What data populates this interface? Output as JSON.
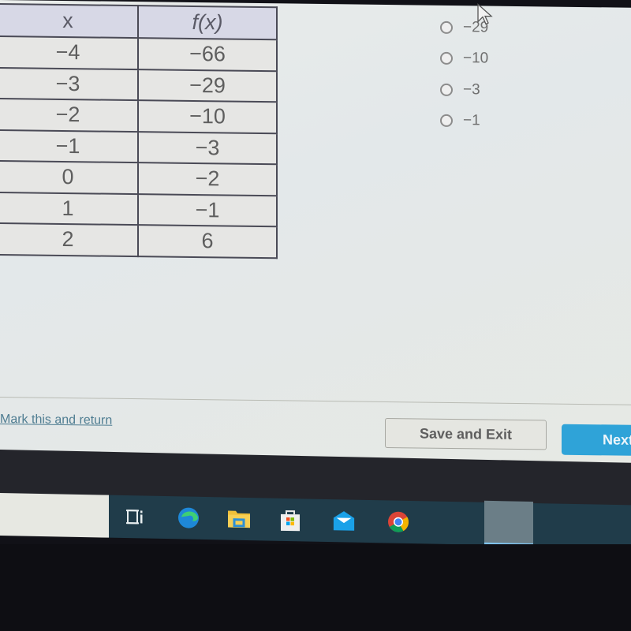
{
  "table": {
    "headers": [
      "x",
      "f(x)"
    ],
    "rows": [
      [
        "−4",
        "−66"
      ],
      [
        "−3",
        "−29"
      ],
      [
        "−2",
        "−10"
      ],
      [
        "−1",
        "−3"
      ],
      [
        "0",
        "−2"
      ],
      [
        "1",
        "−1"
      ],
      [
        "2",
        "6"
      ]
    ]
  },
  "choices": [
    {
      "label": "−29",
      "selected": false
    },
    {
      "label": "−10",
      "selected": false
    },
    {
      "label": "−3",
      "selected": false
    },
    {
      "label": "−1",
      "selected": false
    }
  ],
  "footer": {
    "mark_link": "Mark this and return",
    "save_button": "Save and Exit",
    "next_button": "Next"
  },
  "taskbar": {
    "icons": [
      "task-view-icon",
      "edge-icon",
      "file-explorer-icon",
      "microsoft-store-icon",
      "mail-icon",
      "chrome-icon"
    ],
    "active": "chrome-icon"
  },
  "colors": {
    "accent": "#2fa3d8",
    "link": "#4f7d92",
    "taskbar": "#203c4a"
  }
}
